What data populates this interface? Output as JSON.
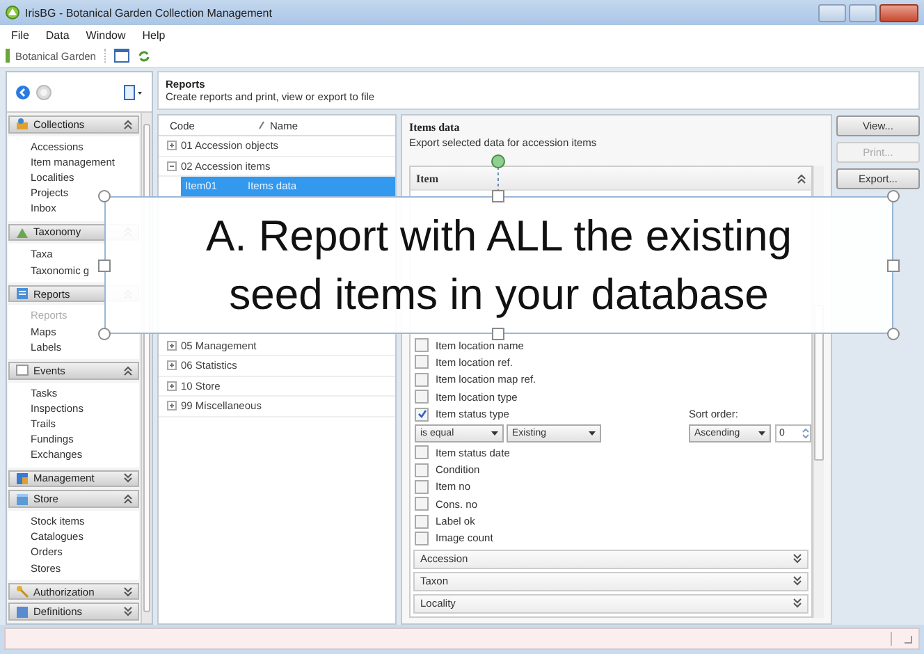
{
  "window": {
    "title": "IrisBG - Botanical Garden Collection Management"
  },
  "menu": [
    "File",
    "Data",
    "Window",
    "Help"
  ],
  "toolbar": {
    "workspace": "Botanical Garden"
  },
  "sidebar": {
    "groups": [
      {
        "label": "Collections",
        "expanded": true,
        "items": [
          {
            "label": "Accessions",
            "selected": false
          },
          {
            "label": "Item management",
            "selected": false
          },
          {
            "label": "Localities",
            "selected": false
          },
          {
            "label": "Projects",
            "selected": false
          },
          {
            "label": "Inbox",
            "selected": false
          }
        ]
      },
      {
        "label": "Taxonomy",
        "expanded": true,
        "items": [
          {
            "label": "Taxa",
            "selected": false
          },
          {
            "label": "Taxonomic g",
            "selected": false
          }
        ]
      },
      {
        "label": "Reports",
        "expanded": true,
        "items": [
          {
            "label": "Reports",
            "selected": true
          },
          {
            "label": "Maps",
            "selected": false
          },
          {
            "label": "Labels",
            "selected": false
          }
        ]
      },
      {
        "label": "Events",
        "expanded": true,
        "items": [
          {
            "label": "Tasks",
            "selected": false
          },
          {
            "label": "Inspections",
            "selected": false
          },
          {
            "label": "Trails",
            "selected": false
          },
          {
            "label": "Fundings",
            "selected": false
          },
          {
            "label": "Exchanges",
            "selected": false
          }
        ]
      },
      {
        "label": "Management",
        "expanded": false
      },
      {
        "label": "Store",
        "expanded": true,
        "items": [
          {
            "label": "Stock items",
            "selected": false
          },
          {
            "label": "Catalogues",
            "selected": false
          },
          {
            "label": "Orders",
            "selected": false
          },
          {
            "label": "Stores",
            "selected": false
          }
        ]
      },
      {
        "label": "Authorization",
        "expanded": false
      },
      {
        "label": "Definitions",
        "expanded": false
      }
    ]
  },
  "header": {
    "title": "Reports",
    "subtitle": "Create reports and print, view or export to file"
  },
  "report_tree": {
    "columns": [
      "Code",
      "Name"
    ],
    "items": [
      {
        "label": "01 Accession objects",
        "expanded": false
      },
      {
        "label": "02 Accession items",
        "expanded": true,
        "children": [
          {
            "code": "Item01",
            "name": "Items data",
            "selected": true
          }
        ]
      },
      {
        "label": "05 Management",
        "expanded": false
      },
      {
        "label": "06 Statistics",
        "expanded": false
      },
      {
        "label": "10 Store",
        "expanded": false
      },
      {
        "label": "99 Miscellaneous",
        "expanded": false
      }
    ]
  },
  "detail": {
    "title": "Items data",
    "description": "Export selected data for accession items",
    "section": "Item",
    "fields": [
      {
        "kind": "checkbox",
        "label": "Item location name",
        "checked": false
      },
      {
        "kind": "checkbox",
        "label": "Item location ref.",
        "checked": false
      },
      {
        "kind": "checkbox",
        "label": "Item location map ref.",
        "checked": false
      },
      {
        "kind": "checkbox",
        "label": "Item location type",
        "checked": false
      },
      {
        "kind": "filter",
        "label": "Item status type",
        "checked": true,
        "operator": "is equal",
        "value": "Existing",
        "sort_label": "Sort order:",
        "sort_value": "Ascending",
        "sort_index": "0"
      },
      {
        "kind": "checkbox",
        "label": "Item status date",
        "checked": false
      },
      {
        "kind": "checkbox",
        "label": "Condition",
        "checked": false
      },
      {
        "kind": "checkbox",
        "label": "Item no",
        "checked": false
      },
      {
        "kind": "checkbox",
        "label": "Cons. no",
        "checked": false
      },
      {
        "kind": "checkbox",
        "label": "Label ok",
        "checked": false
      },
      {
        "kind": "checkbox",
        "label": "Image count",
        "checked": false
      }
    ],
    "collapsed_sections": [
      "Accession",
      "Taxon",
      "Locality"
    ]
  },
  "actions": [
    {
      "label": "View...",
      "disabled": false
    },
    {
      "label": "Print...",
      "disabled": true
    },
    {
      "label": "Export...",
      "disabled": false
    }
  ],
  "annotation": {
    "text": "A. Report with ALL the existing seed items in your database"
  }
}
